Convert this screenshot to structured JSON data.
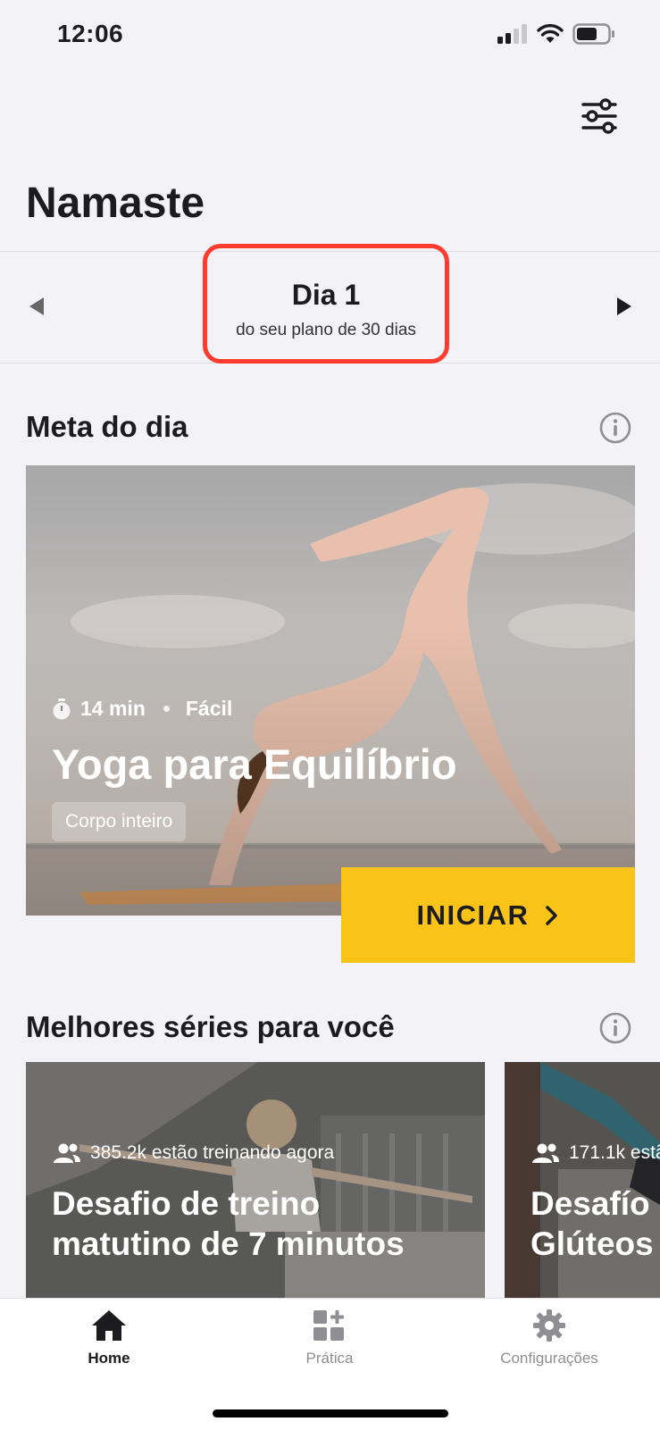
{
  "status_bar": {
    "time": "12:06"
  },
  "header": {
    "title": "Namaste"
  },
  "day_selector": {
    "title": "Dia 1",
    "subtitle": "do seu plano de 30 dias"
  },
  "daily_goal": {
    "section_title": "Meta do dia",
    "duration": "14 min",
    "difficulty": "Fácil",
    "workout_title": "Yoga para Equilíbrio",
    "tag": "Corpo inteiro",
    "start_label": "INICIAR"
  },
  "series": {
    "section_title": "Melhores séries para você",
    "cards": [
      {
        "users": "385.2k estão treinando agora",
        "title_line1": "Desafio de treino",
        "title_line2": "matutino de 7 minutos"
      },
      {
        "users": "171.1k estã",
        "title_line1": "Desafío",
        "title_line2": "Glúteos"
      }
    ]
  },
  "tab_bar": {
    "items": [
      {
        "label": "Home",
        "icon": "home-icon",
        "active": true
      },
      {
        "label": "Prática",
        "icon": "grid-plus-icon",
        "active": false
      },
      {
        "label": "Configurações",
        "icon": "gear-icon",
        "active": false
      }
    ]
  },
  "colors": {
    "accent": "#f9c417",
    "highlight_border": "#ff3b30",
    "background": "#f2f2f7"
  }
}
